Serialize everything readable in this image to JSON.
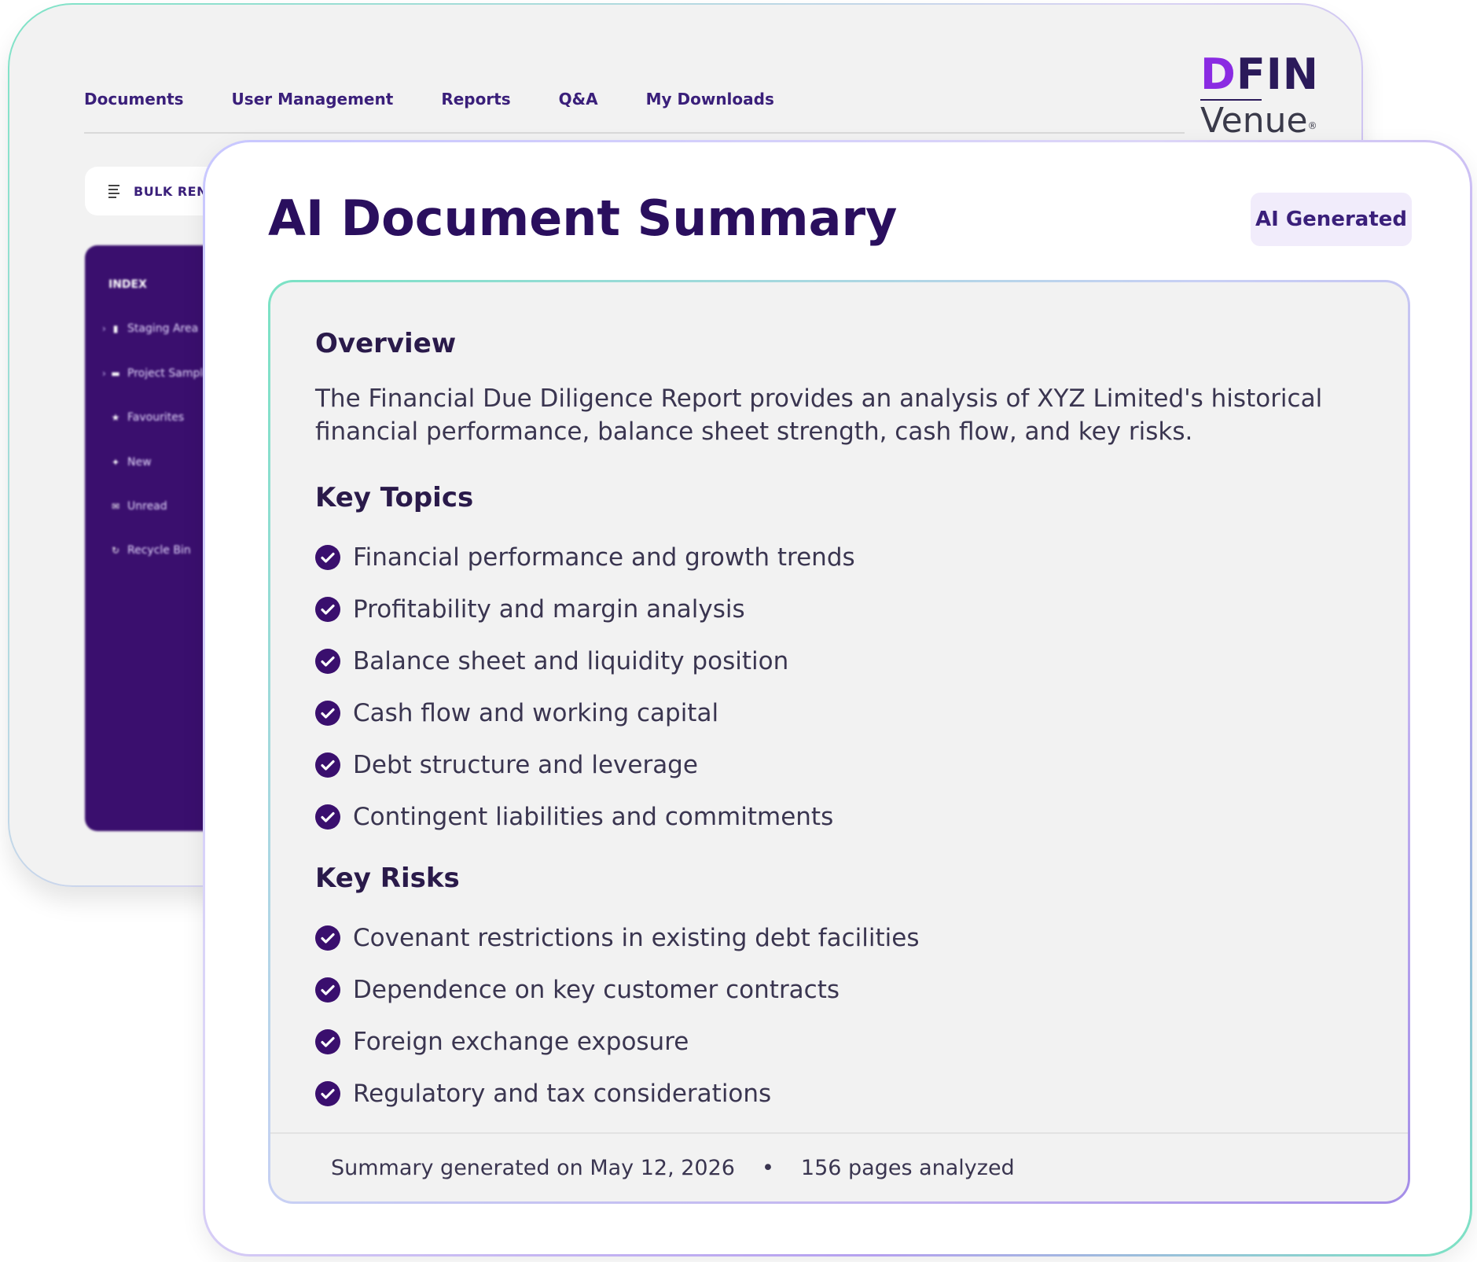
{
  "background_app": {
    "nav": [
      "Documents",
      "User Management",
      "Reports",
      "Q&A",
      "My Downloads"
    ],
    "logo": {
      "brand": "DFIN",
      "product": "Venue"
    },
    "bulk_button_label": "BULK RENA",
    "sidebar": {
      "index_label": "INDEX",
      "items": [
        {
          "label": "Staging Area",
          "icon": "file-icon",
          "expandable": true
        },
        {
          "label": "Project Sample",
          "icon": "folder-icon",
          "expandable": true
        },
        {
          "label": "Favourites",
          "icon": "star-icon",
          "expandable": false
        },
        {
          "label": "New",
          "icon": "new-icon",
          "expandable": false
        },
        {
          "label": "Unread",
          "icon": "envelope-icon",
          "expandable": false
        },
        {
          "label": "Recycle Bin",
          "icon": "recycle-icon",
          "expandable": false
        }
      ]
    }
  },
  "summary_card": {
    "title": "AI Document Summary",
    "badge": "AI Generated",
    "overview": {
      "heading": "Overview",
      "text": "The Financial Due Diligence Report provides an analysis of XYZ Limited's historical financial performance, balance sheet strength, cash flow, and key risks."
    },
    "key_topics": {
      "heading": "Key Topics",
      "items": [
        "Financial performance and growth trends",
        "Profitability and margin analysis",
        "Balance sheet and liquidity position",
        "Cash flow and working capital",
        "Debt structure and leverage",
        "Contingent liabilities and commitments"
      ]
    },
    "key_risks": {
      "heading": "Key Risks",
      "items": [
        "Covenant restrictions in existing debt facilities",
        "Dependence on key customer contracts",
        "Foreign exchange exposure",
        "Regulatory and tax considerations"
      ]
    },
    "footer": {
      "generated": "Summary generated on May 12, 2026",
      "separator": "•",
      "pages": "156 pages analyzed"
    }
  },
  "colors": {
    "primary_purple": "#2a0f5e",
    "sidebar_purple": "#3a0f6e",
    "check_fill": "#3a0f6e",
    "badge_bg": "#f1ecfb",
    "accent_teal": "#7ae2c4"
  }
}
